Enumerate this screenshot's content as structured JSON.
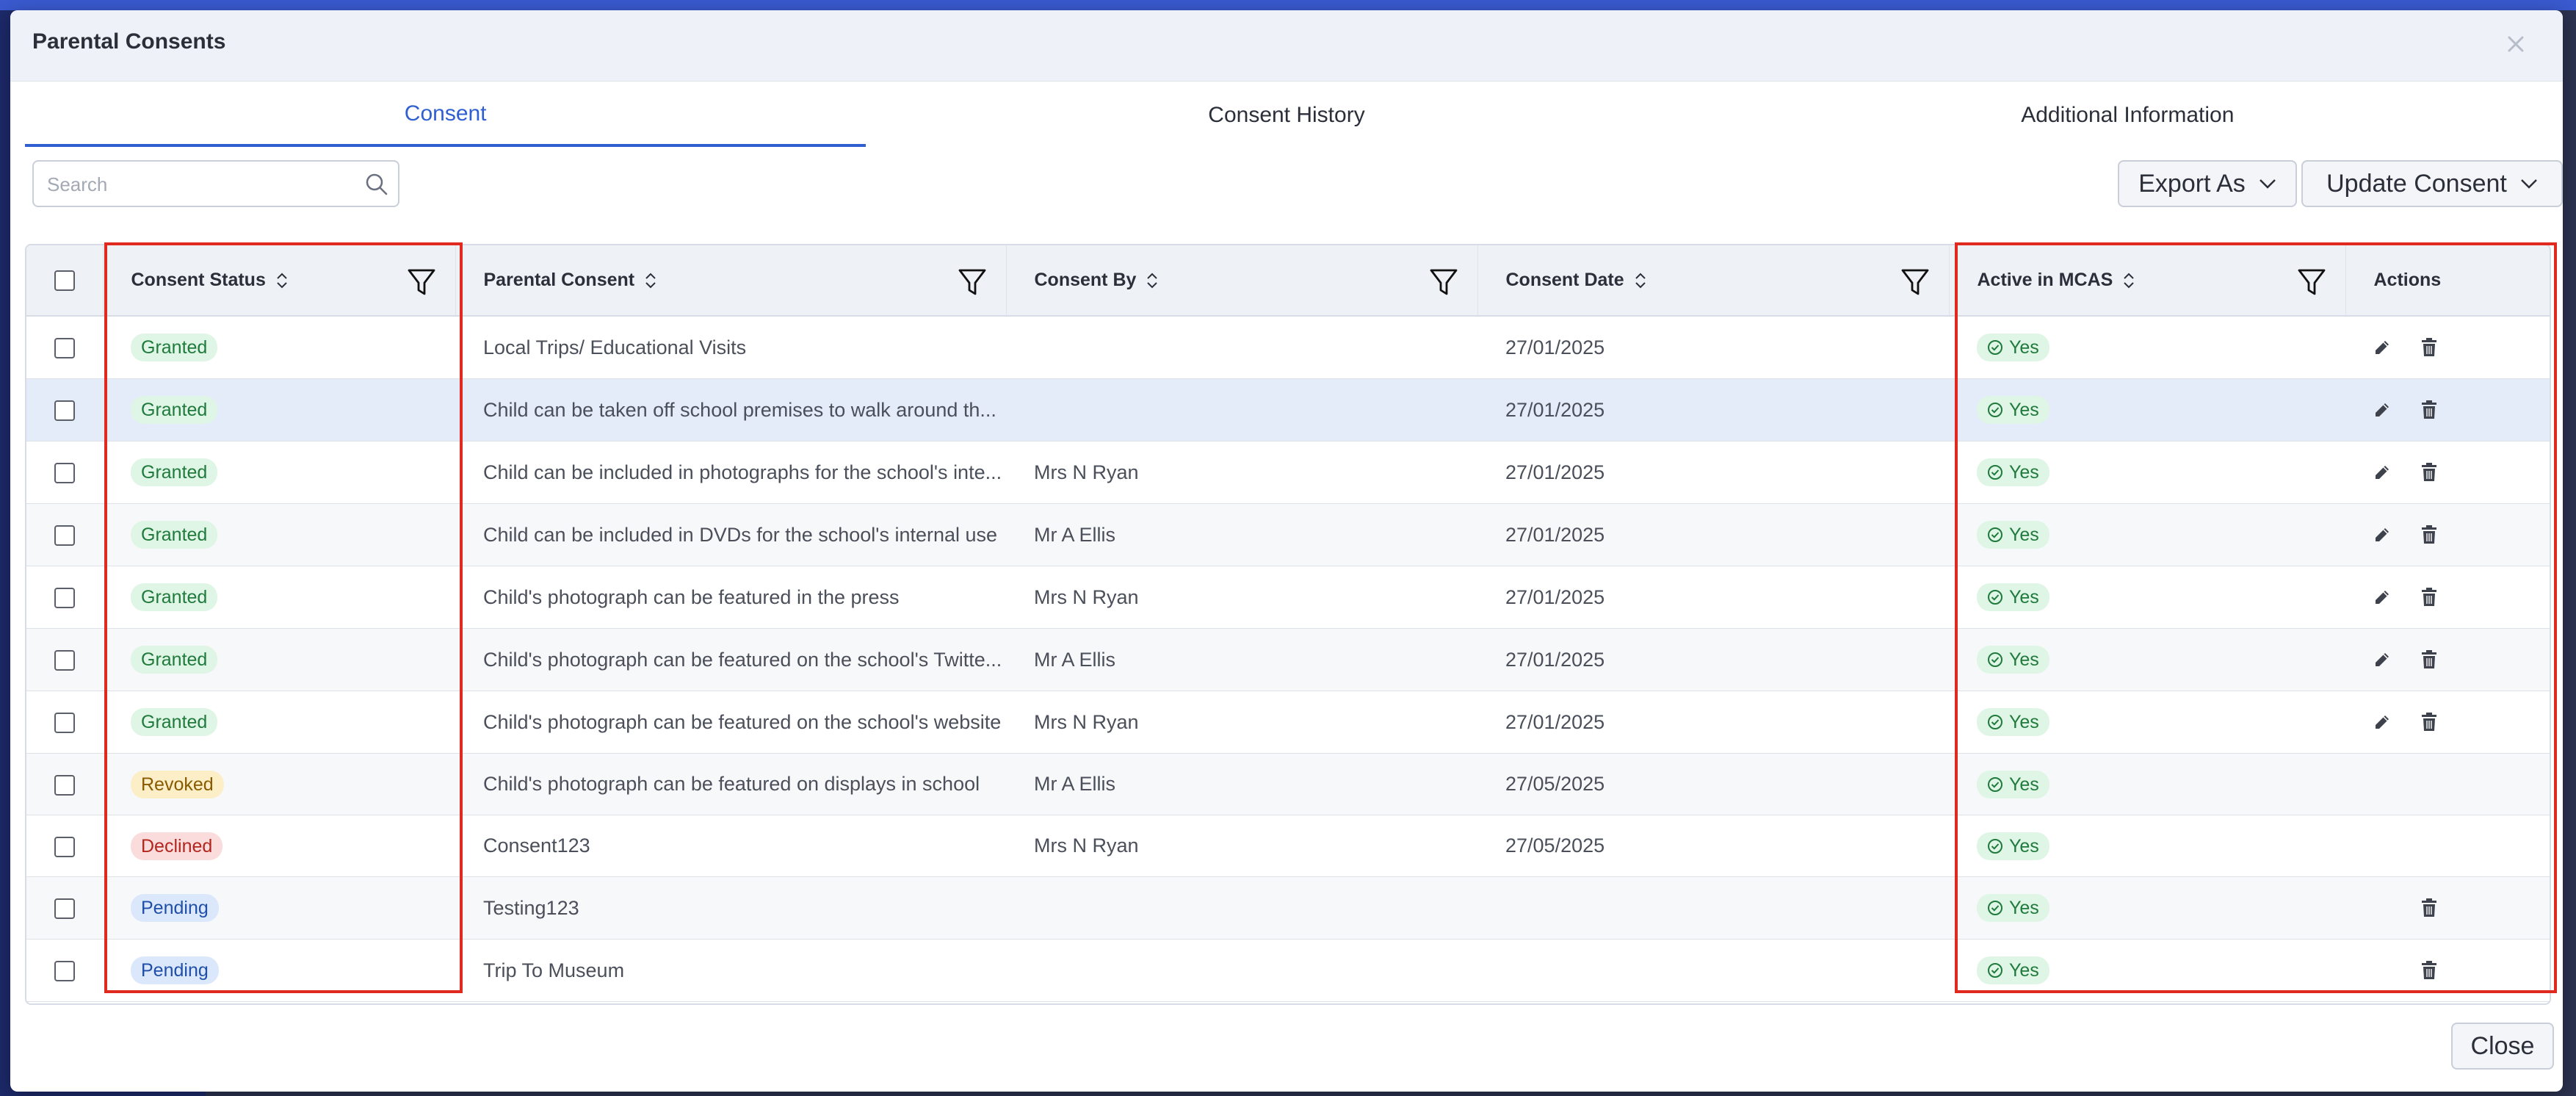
{
  "modal": {
    "title": "Parental Consents"
  },
  "tabs": [
    {
      "label": "Consent",
      "active": true
    },
    {
      "label": "Consent History",
      "active": false
    },
    {
      "label": "Additional Information",
      "active": false
    }
  ],
  "toolbar": {
    "search_placeholder": "Search",
    "export_label": "Export As",
    "update_label": "Update Consent"
  },
  "table": {
    "columns": [
      {
        "label": "Consent Status"
      },
      {
        "label": "Parental Consent"
      },
      {
        "label": "Consent By"
      },
      {
        "label": "Consent Date"
      },
      {
        "label": "Active in MCAS"
      },
      {
        "label": "Actions"
      }
    ],
    "rows": [
      {
        "status": "Granted",
        "consent": "Local Trips/ Educational Visits",
        "by": "",
        "date": "27/01/2025",
        "active": "Yes"
      },
      {
        "status": "Granted",
        "consent": "Child can be taken off school premises to walk around th...",
        "by": "",
        "date": "27/01/2025",
        "active": "Yes"
      },
      {
        "status": "Granted",
        "consent": "Child can be included in photographs for the school's inte...",
        "by": "Mrs N Ryan",
        "date": "27/01/2025",
        "active": "Yes"
      },
      {
        "status": "Granted",
        "consent": "Child can be included in DVDs for the school's internal use",
        "by": "Mr A Ellis",
        "date": "27/01/2025",
        "active": "Yes"
      },
      {
        "status": "Granted",
        "consent": "Child's photograph can be featured in the press",
        "by": "Mrs N Ryan",
        "date": "27/01/2025",
        "active": "Yes"
      },
      {
        "status": "Granted",
        "consent": "Child's photograph can be featured on the school's Twitte...",
        "by": "Mr A Ellis",
        "date": "27/01/2025",
        "active": "Yes"
      },
      {
        "status": "Granted",
        "consent": "Child's photograph can be featured on the school's website",
        "by": "Mrs N Ryan",
        "date": "27/01/2025",
        "active": "Yes"
      },
      {
        "status": "Revoked",
        "consent": "Child's photograph can be featured on displays in school",
        "by": "Mr A Ellis",
        "date": "27/05/2025",
        "active": "Yes"
      },
      {
        "status": "Declined",
        "consent": "Consent123",
        "by": "Mrs N Ryan",
        "date": "27/05/2025",
        "active": "Yes"
      },
      {
        "status": "Pending",
        "consent": "Testing123",
        "by": "",
        "date": "",
        "active": "Yes"
      },
      {
        "status": "Pending",
        "consent": "Trip To Museum",
        "by": "",
        "date": "",
        "active": "Yes"
      }
    ]
  },
  "footer": {
    "close_label": "Close"
  },
  "colors": {
    "accent": "#2f5fd0",
    "granted": "#1f7a3c",
    "revoked": "#8a5a00",
    "declined": "#b3261e",
    "pending": "#1f4fa8",
    "highlight": "#e12a1f"
  }
}
